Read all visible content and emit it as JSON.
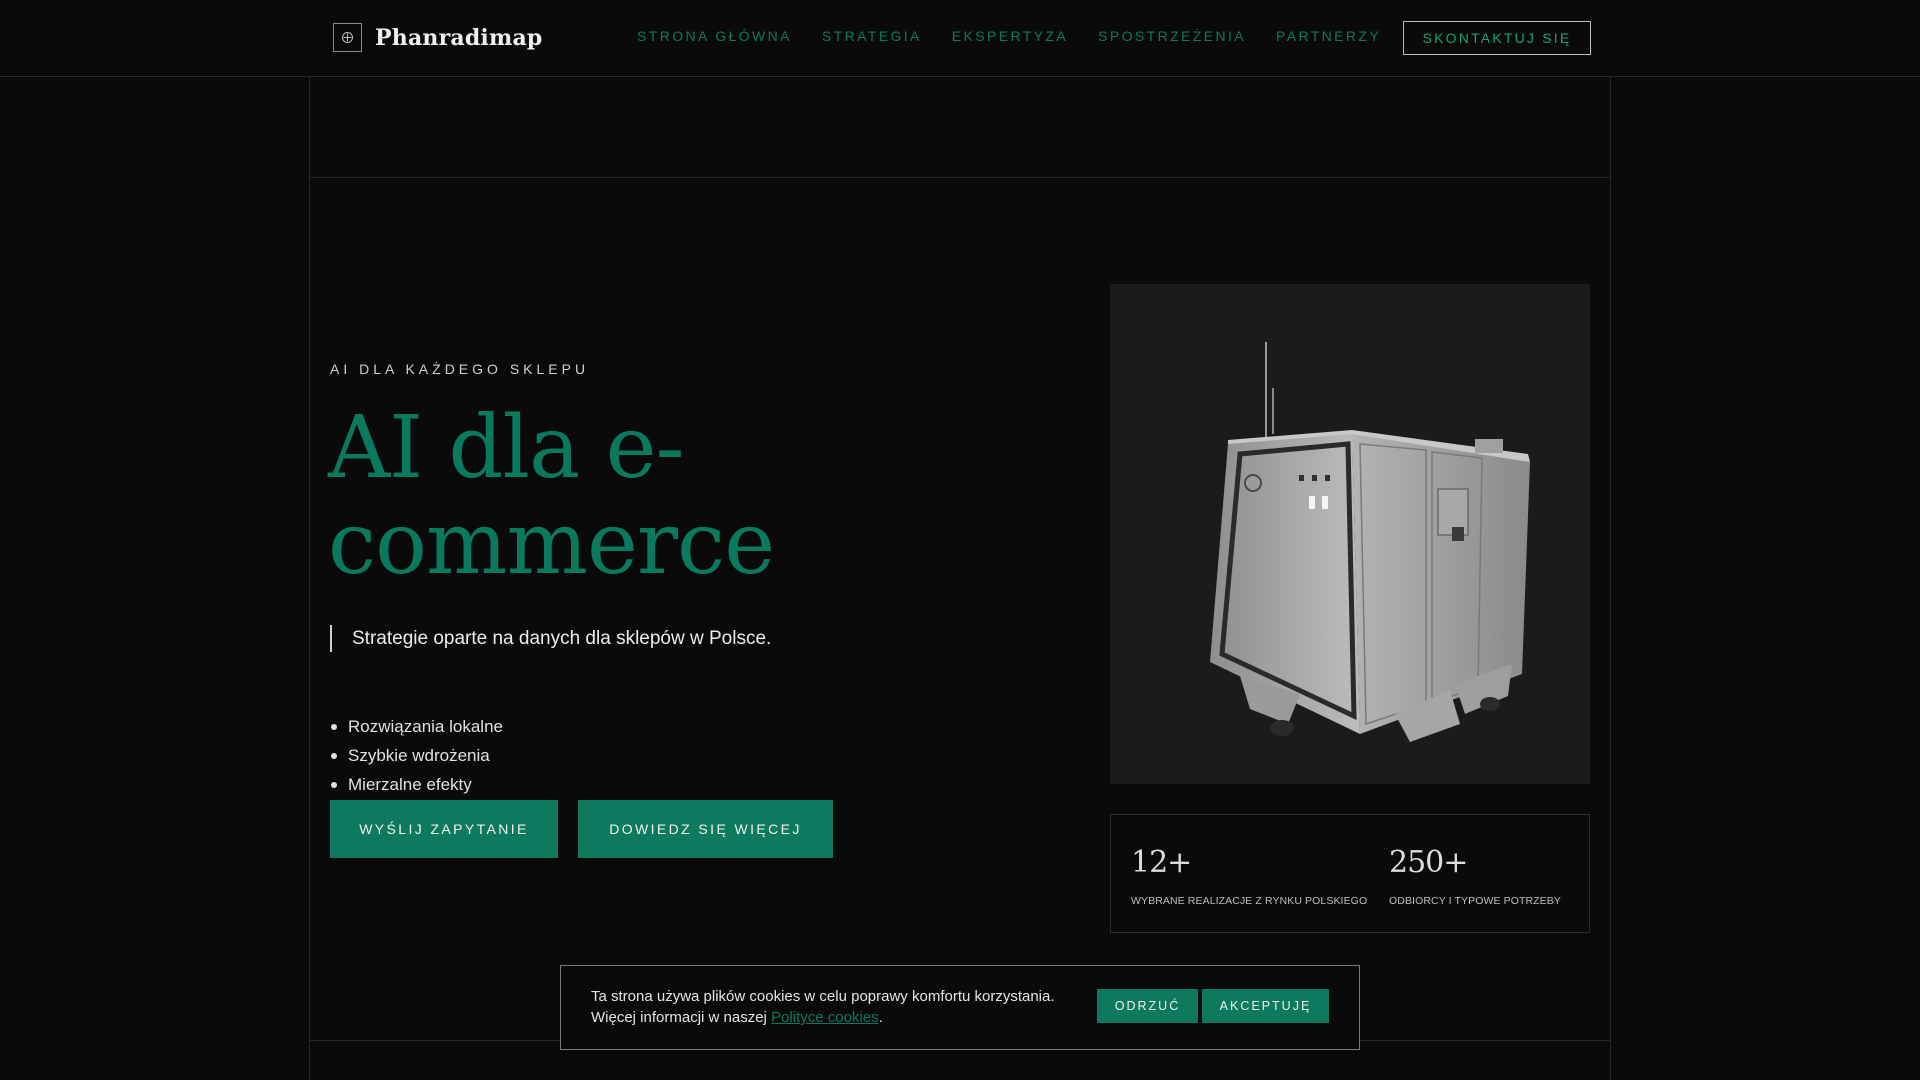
{
  "header": {
    "logo_text": "Phanradimap",
    "nav": [
      {
        "label": "STRONA GŁÓWNA"
      },
      {
        "label": "STRATEGIA"
      },
      {
        "label": "EKSPERTYZA"
      },
      {
        "label": "SPOSTRZEŻENIA"
      },
      {
        "label": "PARTNERZY"
      }
    ],
    "contact_label": "SKONTAKTUJ SIĘ"
  },
  "hero": {
    "eyebrow": "AI DLA KAŻDEGO SKLEPU",
    "title": "AI dla e-commerce",
    "subtitle": "Strategie oparte na danych dla sklepów w Polsce.",
    "features": [
      {
        "label": "Rozwiązania lokalne"
      },
      {
        "label": "Szybkie wdrożenia"
      },
      {
        "label": "Mierzalne efekty"
      }
    ],
    "primary_button": "WYŚLIJ ZAPYTANIE",
    "secondary_button": "DOWIEDZ SIĘ WIĘCEJ"
  },
  "stats": [
    {
      "number": "12+",
      "caption": "WYBRANE REALIZACJE Z RYNKU POLSKIEGO"
    },
    {
      "number": "250+",
      "caption": "ODBIORCY I TYPOWE POTRZEBY"
    }
  ],
  "cookie": {
    "line1": "Ta strona używa plików cookies w celu poprawy komfortu korzystania.",
    "line2_prefix": "Więcej informacji w naszej ",
    "link": "Polityce cookies",
    "line2_suffix": ".",
    "reject": "ODRZUĆ",
    "accept": "AKCEPTUJĘ"
  },
  "colors": {
    "accent": "#0e7a5d",
    "background": "#0a0a0a"
  }
}
